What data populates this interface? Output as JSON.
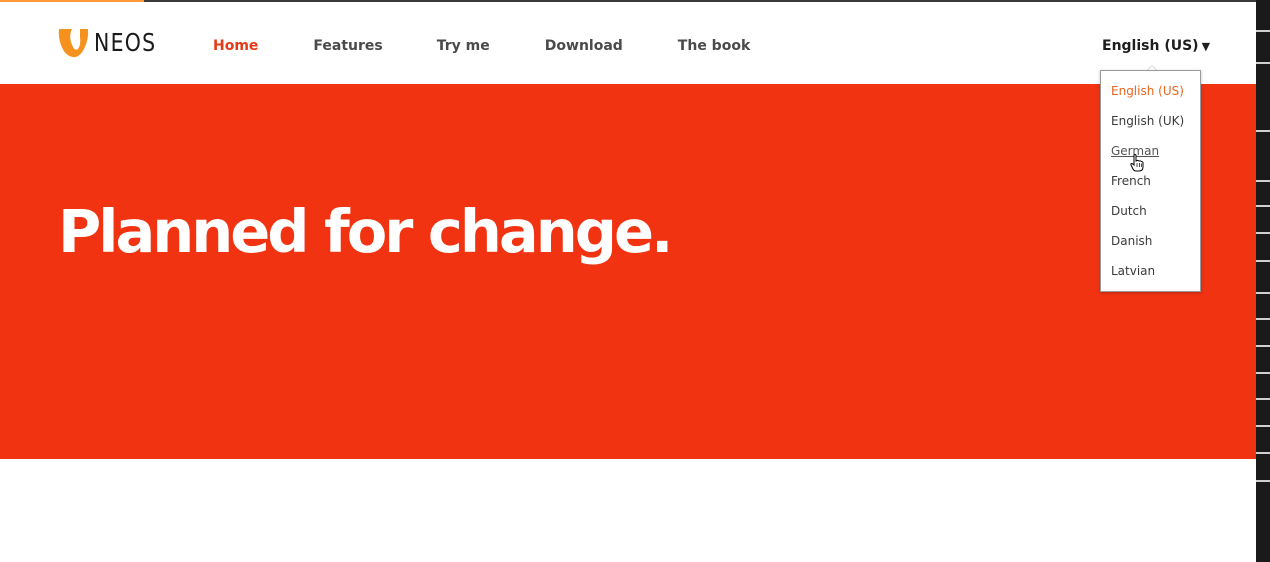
{
  "brand": {
    "name": "NEOS",
    "logo_icon": "neos-logo-icon",
    "logo_color": "#f5921e"
  },
  "nav": {
    "items": [
      {
        "label": "Home",
        "active": true
      },
      {
        "label": "Features",
        "active": false
      },
      {
        "label": "Try me",
        "active": false
      },
      {
        "label": "Download",
        "active": false
      },
      {
        "label": "The book",
        "active": false
      }
    ]
  },
  "language": {
    "selected": "English (US)",
    "caret_icon": "caret-down-icon",
    "options": [
      "English (US)",
      "English (UK)",
      "German",
      "French",
      "Dutch",
      "Danish",
      "Latvian"
    ],
    "hovered": "German"
  },
  "hero": {
    "title": "Planned for change.",
    "background": "#f13312"
  },
  "colors": {
    "accent": "#e33a17",
    "current_language": "#e9651f"
  }
}
